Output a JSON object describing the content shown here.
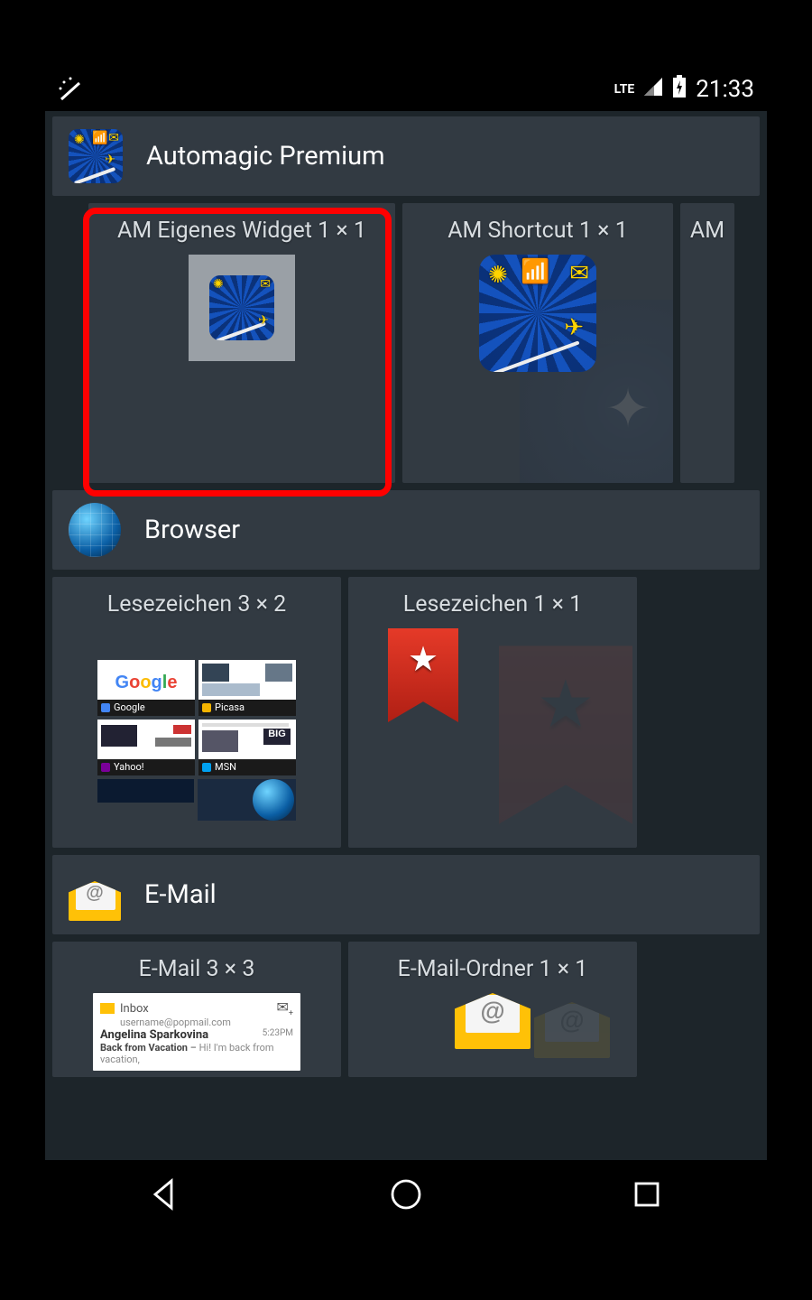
{
  "status_bar": {
    "network": "LTE",
    "time": "21:33"
  },
  "highlight_target": "widget-am-eigenes",
  "sections": [
    {
      "id": "automagic",
      "title": "Automagic Premium",
      "icon": "automagic-icon",
      "widgets": [
        {
          "id": "am-eigenes",
          "label": "AM Eigenes Widget 1 × 1",
          "preview": "am-slot"
        },
        {
          "id": "am-shortcut",
          "label": "AM Shortcut 1 × 1",
          "preview": "am-big"
        },
        {
          "id": "am-partial",
          "label": "AM",
          "preview": "am-ghost",
          "partial": true
        }
      ]
    },
    {
      "id": "browser",
      "title": "Browser",
      "icon": "globe-icon",
      "widgets": [
        {
          "id": "lesezeichen-3x2",
          "label": "Lesezeichen 3 × 2",
          "preview": "bookmark-grid",
          "bookmarks": [
            "Google",
            "Picasa",
            "Yahoo!",
            "MSN"
          ]
        },
        {
          "id": "lesezeichen-1x1",
          "label": "Lesezeichen 1 × 1",
          "preview": "bookmark-ribbon"
        }
      ]
    },
    {
      "id": "email",
      "title": "E-Mail",
      "icon": "mail-icon",
      "widgets": [
        {
          "id": "email-3x3",
          "label": "E-Mail 3 × 3",
          "preview": "email-list",
          "sample": {
            "folder": "Inbox",
            "address": "username@popmail.com",
            "sender": "Angelina Sparkovina",
            "time": "5:23PM",
            "subject": "Back from Vacation",
            "body": "Hi! I'm back from vacation,"
          }
        },
        {
          "id": "email-ordner-1x1",
          "label": "E-Mail-Ordner 1 × 1",
          "preview": "mail-big"
        }
      ]
    }
  ]
}
